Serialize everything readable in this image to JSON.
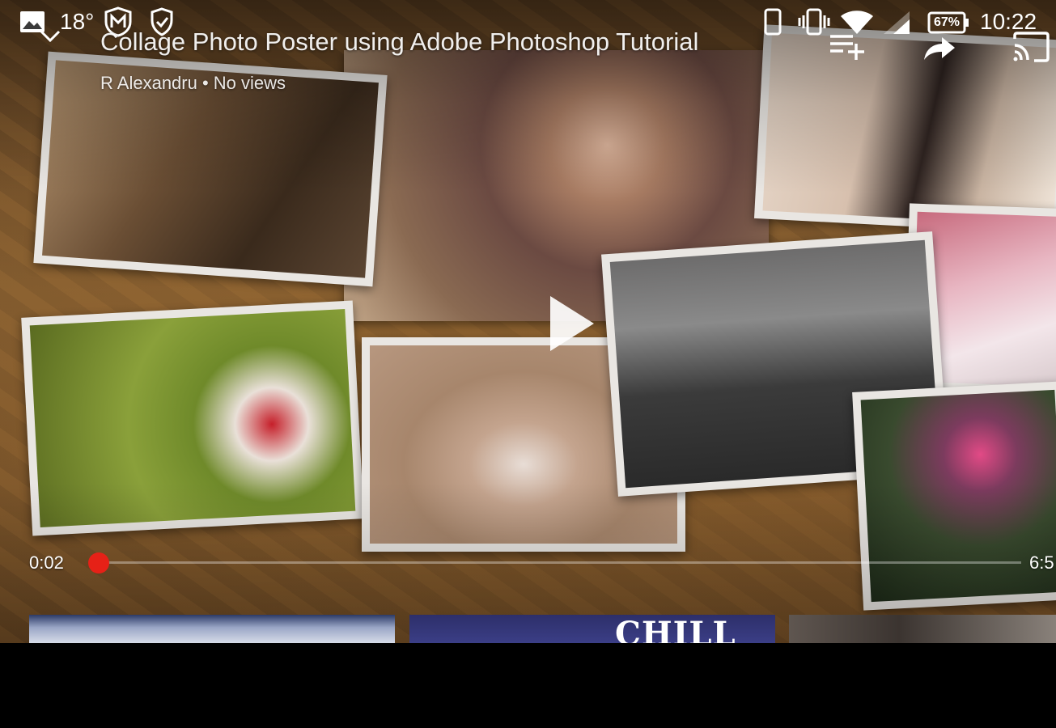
{
  "status_bar": {
    "temperature": "18°",
    "battery_percent": "67%",
    "time": "10:22",
    "icons": [
      "image-icon",
      "mcafee-shield-icon",
      "shield-check-icon",
      "phone-icon",
      "vibrate-icon",
      "wifi-icon",
      "cellular-signal-icon",
      "battery-icon"
    ]
  },
  "player": {
    "title": "Collage Photo Poster using Adobe Photoshop Tutorial",
    "meta": "R Alexandru • No views",
    "current_time": "0:02",
    "total_time": "6:5",
    "progress_fraction": 0.0,
    "actions": [
      "add-to-playlist-icon",
      "share-icon",
      "cast-icon"
    ],
    "accent_color": "#e62117"
  },
  "suggestions": [
    {
      "caption": ""
    },
    {
      "caption": "CHILL"
    },
    {
      "caption": ""
    }
  ]
}
